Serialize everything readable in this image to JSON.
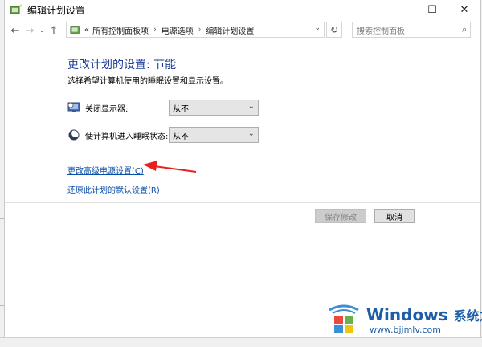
{
  "window": {
    "title": "编辑计划设置",
    "controls": {
      "minimize": "—",
      "maximize": "☐",
      "close": "✕"
    }
  },
  "nav": {
    "back": "←",
    "forward": "→",
    "recent": "⌄",
    "up": "↑",
    "breadcrumb": {
      "overflow": "«",
      "items": [
        "所有控制面板项",
        "电源选项",
        "编辑计划设置"
      ],
      "separator": "›"
    },
    "dropdown": "⌄",
    "refresh": "↻",
    "search_placeholder": "搜索控制面板",
    "search_icon": "⌕"
  },
  "main": {
    "heading": "更改计划的设置: 节能",
    "subtitle": "选择希望计算机使用的睡眠设置和显示设置。",
    "settings": [
      {
        "label": "关闭显示器:",
        "value": "从不",
        "icon": "monitor-icon"
      },
      {
        "label": "使计算机进入睡眠状态:",
        "value": "从不",
        "icon": "moon-icon"
      }
    ],
    "links": {
      "advanced": "更改高级电源设置(C)",
      "restore": "还原此计划的默认设置(R)"
    },
    "buttons": {
      "save": "保存修改",
      "cancel": "取消"
    }
  },
  "watermark": {
    "brand": "Windows",
    "brand_cn": "系统之家",
    "url": "www.bjjmlv.com"
  },
  "colors": {
    "heading": "#1e3c96",
    "link": "#0a4ea8",
    "arrow": "#e8201e",
    "watermark": "#1c5fa8"
  }
}
